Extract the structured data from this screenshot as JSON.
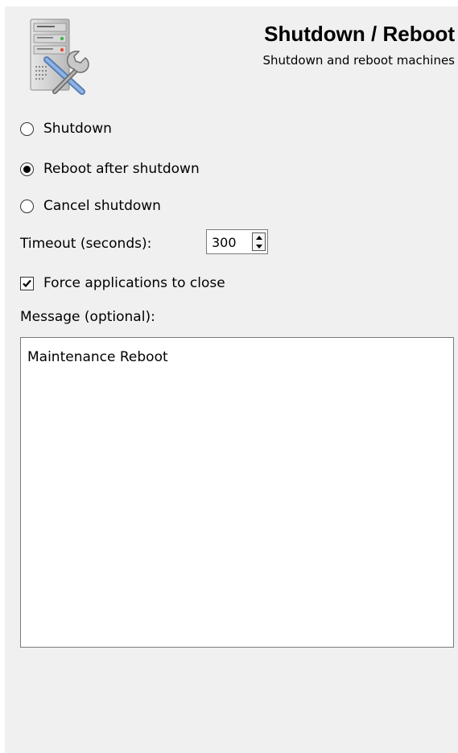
{
  "header": {
    "title": "Shutdown / Reboot",
    "subtitle": "Shutdown and reboot machines",
    "icon": "server-tools-icon"
  },
  "options": [
    {
      "label": "Shutdown",
      "checked": false
    },
    {
      "label": "Reboot after shutdown",
      "checked": true
    },
    {
      "label": "Cancel shutdown",
      "checked": false
    }
  ],
  "timeout": {
    "label": "Timeout (seconds):",
    "value": "300"
  },
  "force": {
    "label": "Force applications to close",
    "checked": true
  },
  "message": {
    "label": "Message (optional):",
    "value": "Maintenance Reboot"
  }
}
